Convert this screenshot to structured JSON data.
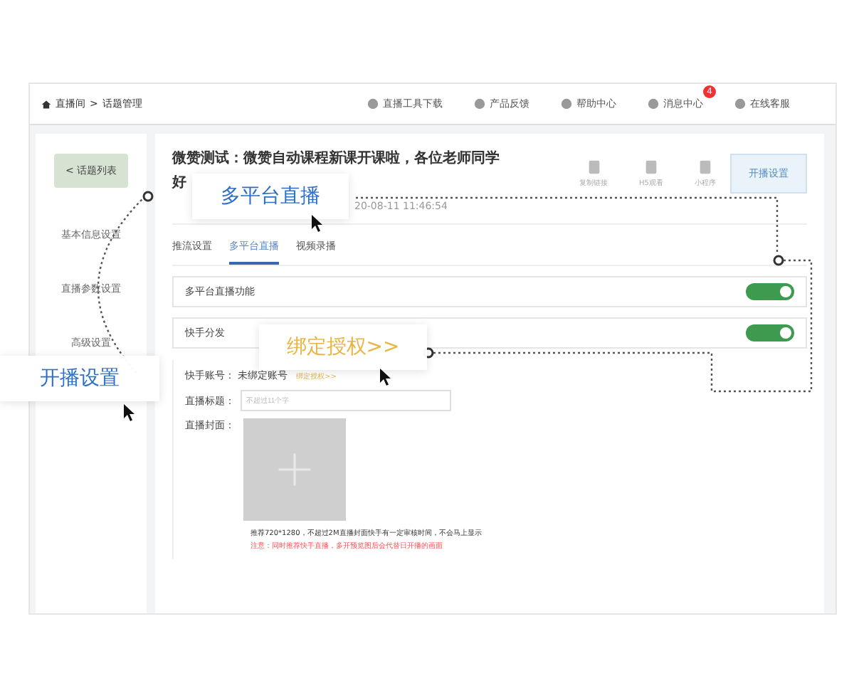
{
  "breadcrumb": {
    "home": "直播间",
    "separator": ">",
    "current": "话题管理"
  },
  "top_links": [
    {
      "label": "直播工具下载"
    },
    {
      "label": "产品反馈"
    },
    {
      "label": "帮助中心"
    },
    {
      "label": "消息中心",
      "badge": "4"
    },
    {
      "label": "在线客服"
    }
  ],
  "sidebar": {
    "back": "< 话题列表",
    "items": [
      "基本信息设置",
      "直播参数设置",
      "高级设置"
    ]
  },
  "topic": {
    "title": "微赞测试：微赞自动课程新课开课啦，各位老师同学",
    "title_cont": "好",
    "date": "20-08-11 11:46:54",
    "actions": [
      "复制链接",
      "H5观看",
      "小程序"
    ],
    "button": "开播设置"
  },
  "tabs": [
    {
      "label": "推流设置",
      "selected": false
    },
    {
      "label": "多平台直播",
      "selected": true
    },
    {
      "label": "视频录播",
      "selected": false
    }
  ],
  "switch_rows": [
    {
      "label": "多平台直播功能",
      "on": true
    },
    {
      "label": "快手分发",
      "on": true
    }
  ],
  "account": {
    "label": "快手账号：",
    "value": "未绑定账号",
    "link": "绑定授权>>"
  },
  "live_title": {
    "label": "直播标题：",
    "placeholder": "不超过11个字"
  },
  "cover": {
    "label": "直播封面：",
    "hint": "推荐720*1280，不超过2M直播封面快手有一定审核时间，不会马上显示",
    "warning": "注意：同时推荐快手直播，多开预览图后会代替日开播的画面"
  },
  "callouts": [
    {
      "text": "多平台直播",
      "kind": "blue"
    },
    {
      "text": "绑定授权>>",
      "kind": "gold"
    },
    {
      "text": "开播设置",
      "kind": "blue"
    }
  ]
}
